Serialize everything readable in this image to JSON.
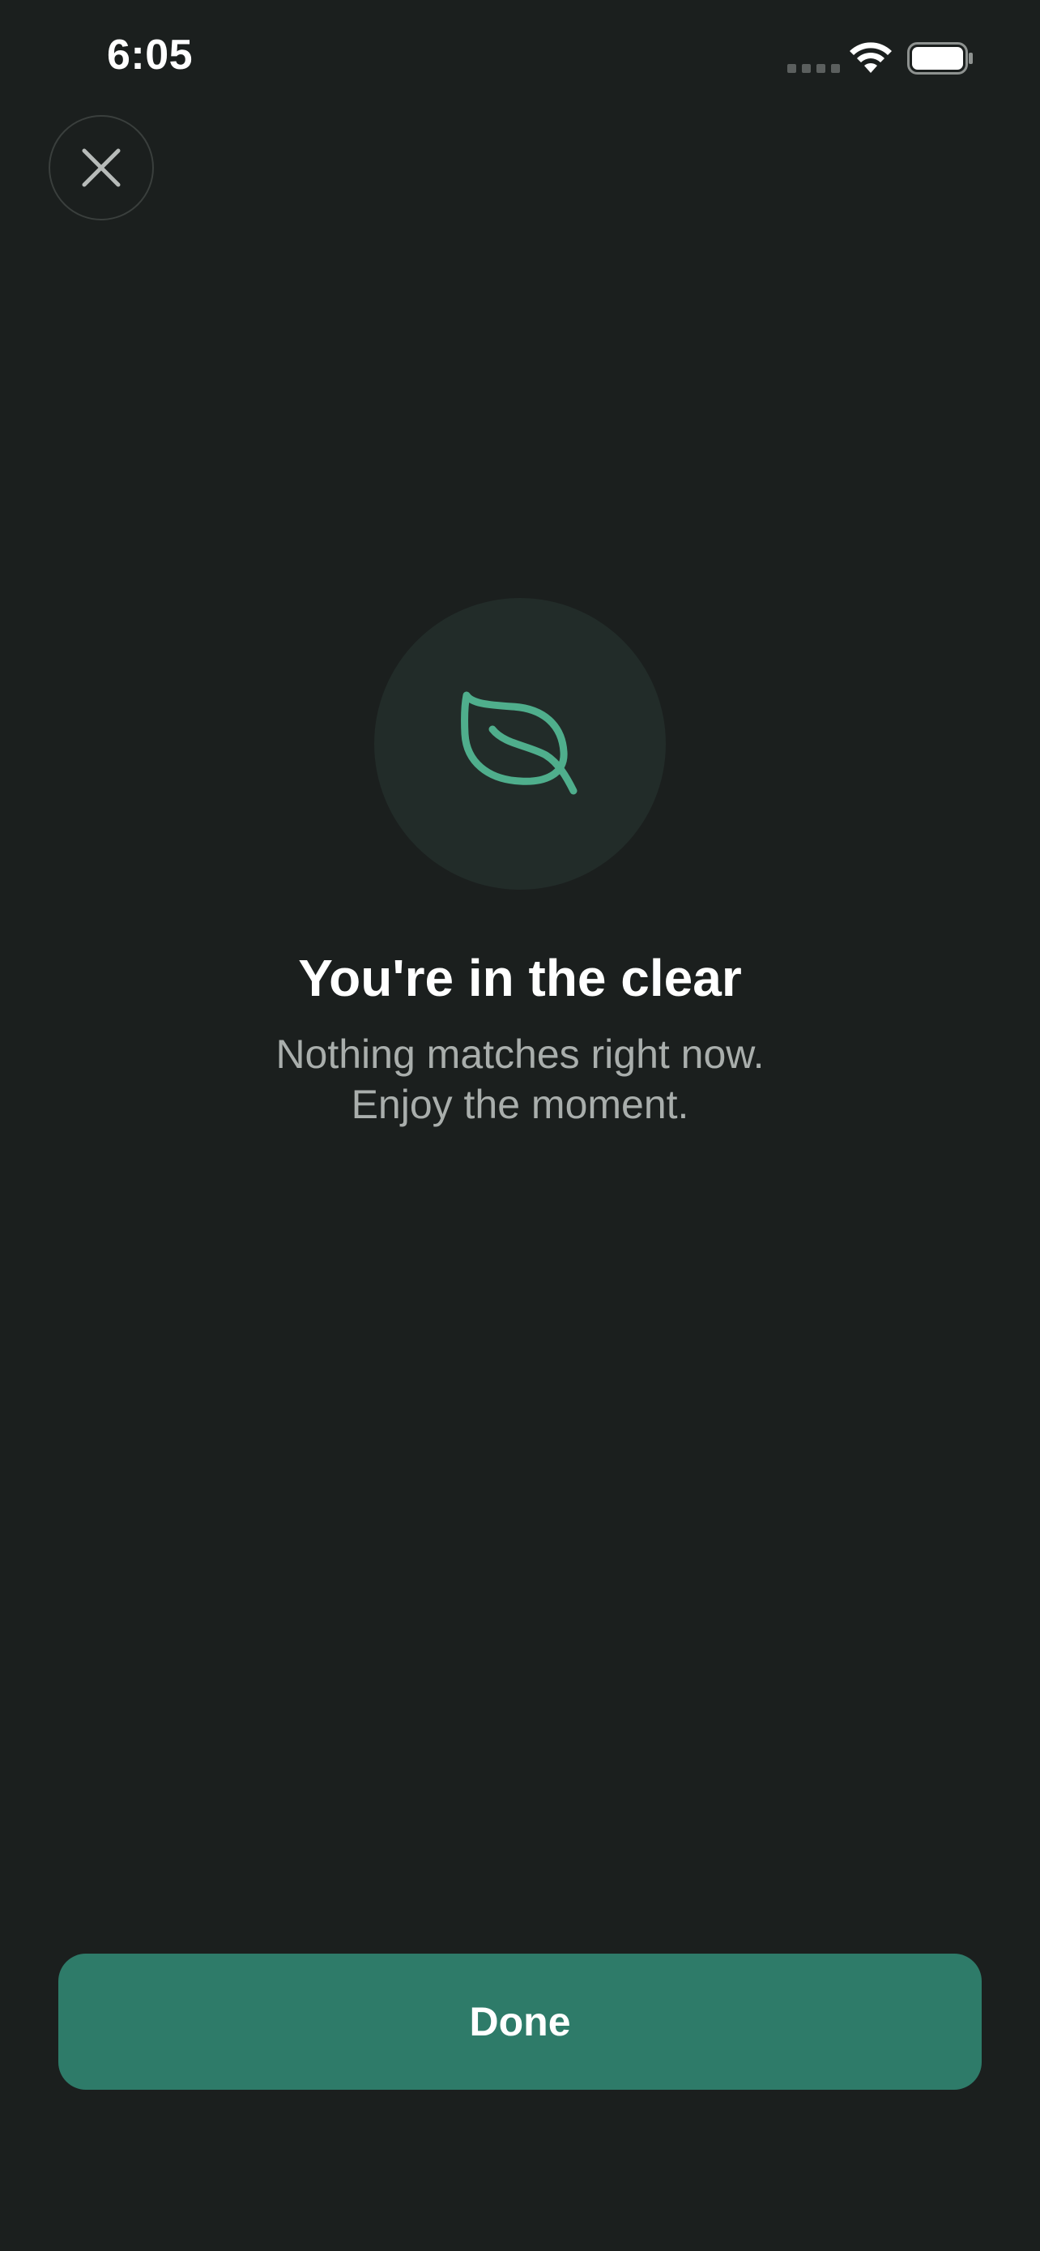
{
  "status_bar": {
    "time": "6:05",
    "signal_icon": "cellular-signal-icon",
    "wifi_icon": "wifi-icon",
    "battery_icon": "battery-icon"
  },
  "header": {
    "close_icon": "close-icon"
  },
  "empty_state": {
    "icon": "leaf-icon",
    "title": "You're in the clear",
    "subtitle_line1": "Nothing matches right now.",
    "subtitle_line2": "Enjoy the moment."
  },
  "footer": {
    "done_label": "Done"
  },
  "colors": {
    "background": "#1b1f1e",
    "accent": "#2e7b69",
    "leaf": "#4fae8c",
    "icon_circle": "#222c29",
    "subtitle": "#a9aeac"
  }
}
